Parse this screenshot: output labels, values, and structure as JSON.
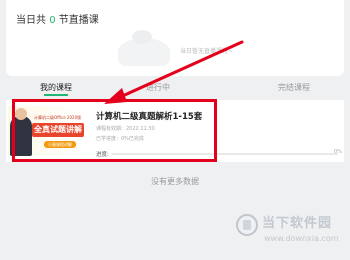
{
  "header": {
    "live_prefix": "当日共",
    "live_count": "0",
    "live_suffix": "节直播课",
    "empty_tip": "当日暂无直播课程~"
  },
  "tabs": [
    {
      "label": "我的课程",
      "active": true
    },
    {
      "label": "进行中",
      "active": false
    },
    {
      "label": "完结课程",
      "active": false
    }
  ],
  "course": {
    "title": "计算机二级真题解析1-15套",
    "meta_line1": "课程有效期：2022.11.30",
    "meta_line2": "已学进度：0%已完成",
    "progress_label": "进度:",
    "progress_end": "0%",
    "progress": 0,
    "thumb_sub": "计算机二级Office 2020版",
    "thumb_title": "全真试题讲解",
    "thumb_tag": "小猿课程讲解"
  },
  "footer": {
    "no_more": "没有更多数据"
  },
  "watermark": {
    "name": "当下软件园",
    "url": "www.downxia.com"
  },
  "colors": {
    "accent": "#22b573",
    "highlight": "#e4001c"
  },
  "icons": {
    "empty": "empty-state-illustration",
    "watermark": "downxia-logo"
  }
}
